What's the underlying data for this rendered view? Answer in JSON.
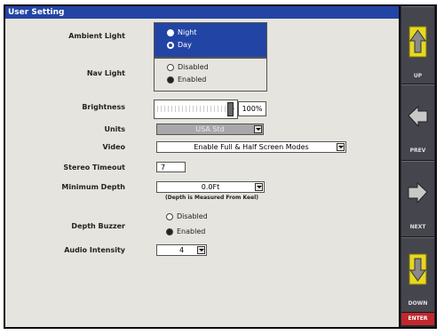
{
  "title": "User Setting",
  "ambient_light": {
    "label": "Ambient Light",
    "options": [
      "Night",
      "Day"
    ],
    "selected": "Day"
  },
  "nav_light": {
    "label": "Nav Light",
    "options": [
      "Disabled",
      "Enabled"
    ],
    "selected": "Enabled"
  },
  "brightness": {
    "label": "Brightness",
    "value_text": "100%",
    "level": 1.0
  },
  "units": {
    "label": "Units",
    "value": "USA Std"
  },
  "video": {
    "label": "Video",
    "value": "Enable Full & Half Screen Modes"
  },
  "stereo_timeout": {
    "label": "Stereo Timeout",
    "value": "7"
  },
  "minimum_depth": {
    "label": "Minimum Depth",
    "value": "0.0Ft",
    "note": "(Depth is Measured From Keel)"
  },
  "depth_buzzer": {
    "label": "Depth Buzzer",
    "options": [
      "Disabled",
      "Enabled"
    ],
    "selected": "Enabled"
  },
  "audio_intensity": {
    "label": "Audio Intensity",
    "value": "4"
  },
  "side_buttons": {
    "up": "UP",
    "prev": "PREV",
    "next": "NEXT",
    "down": "DOWN",
    "enter": "ENTER"
  },
  "colors": {
    "title_bg": "#2244a4",
    "panel_bg": "#e6e4de",
    "yellow": "#e8d820",
    "enter_red": "#c0282c"
  }
}
